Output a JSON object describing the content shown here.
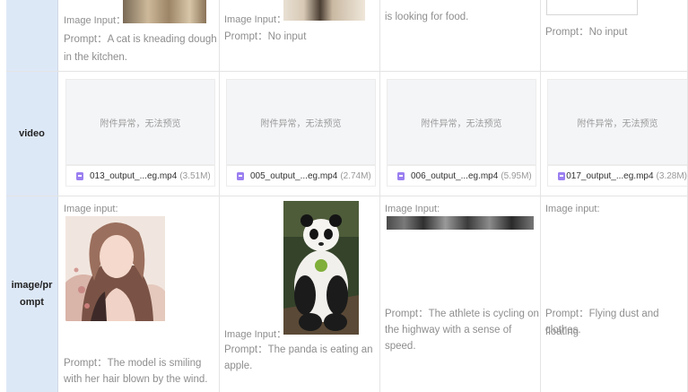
{
  "row_labels": {
    "video": "video",
    "image_prompt_1": "image/pr",
    "image_prompt_2": "ompt"
  },
  "top_row": {
    "col1": {
      "image_input": "Image Input：",
      "prompt_1": "Prompt：A cat is kneading dough",
      "prompt_2": "in the kitchen."
    },
    "col2": {
      "image_input": "Image Input：",
      "prompt": "Prompt：No input"
    },
    "col3": {
      "prompt": "is looking for food."
    },
    "col4": {
      "prompt": "Prompt：No input"
    }
  },
  "video_row": {
    "preview_error": "附件异常，无法预览",
    "files": [
      {
        "name": "013_output_...eg.mp4",
        "size": "(3.51M)"
      },
      {
        "name": "005_output_...eg.mp4",
        "size": "(2.74M)"
      },
      {
        "name": "006_output_...eg.mp4",
        "size": "(5.95M)"
      },
      {
        "name": "017_output_...eg.mp4",
        "size": "(3.28M)"
      }
    ]
  },
  "image_row": {
    "col1": {
      "image_input": "Image input:",
      "prompt_1": "Prompt：The model is smiling",
      "prompt_2": "with her hair blown by the wind."
    },
    "col2": {
      "image_input": "Image Input：",
      "prompt_1": "Prompt：The panda is eating an",
      "prompt_2": "apple."
    },
    "col3": {
      "image_input": "Image Input:",
      "prompt_1": "Prompt：The athlete is cycling on",
      "prompt_2": "the highway with a sense of",
      "prompt_3": "speed."
    },
    "col4": {
      "image_input": "Image input:",
      "prompt_1": "Prompt：Flying dust and floating",
      "prompt_2": "clothes."
    }
  },
  "colors": {
    "label_bg": "#dde8f7",
    "preview_bg": "#f4f5f7",
    "file_icon": "#9b7ff0"
  }
}
